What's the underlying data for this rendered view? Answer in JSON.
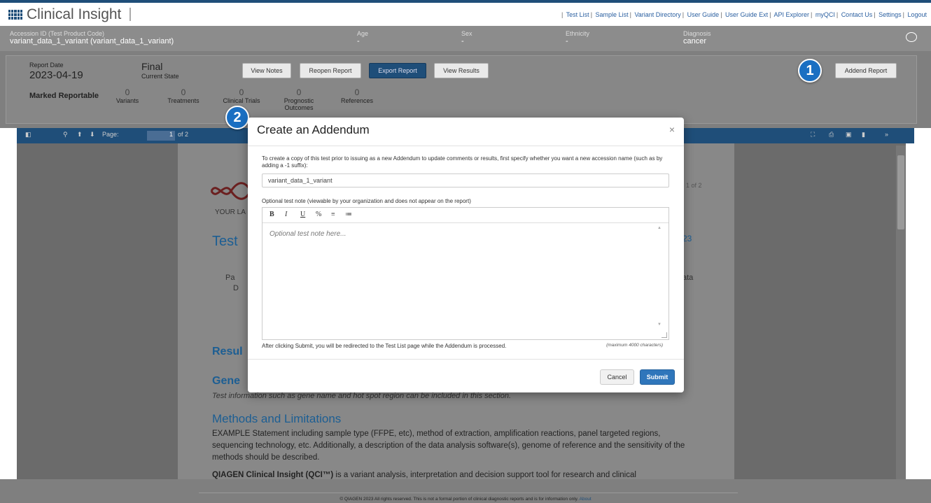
{
  "app": {
    "title": "Clinical Insight"
  },
  "nav_links": [
    "Test List",
    "Sample List",
    "Variant Directory",
    "User Guide",
    "User Guide Ext",
    "API Explorer",
    "myQCI",
    "Contact Us",
    "Settings",
    "Logout"
  ],
  "accession": {
    "accession_label": "Accession ID (Test Product Code)",
    "accession_value": "variant_data_1_variant  (variant_data_1_variant)",
    "age_label": "Age",
    "age_value": "-",
    "sex_label": "Sex",
    "sex_value": "-",
    "ethnicity_label": "Ethnicity",
    "ethnicity_value": "-",
    "diagnosis_label": "Diagnosis",
    "diagnosis_value": "cancer"
  },
  "report": {
    "date_label": "Report Date",
    "date_value": "2023-04-19",
    "state_value": "Final",
    "state_label": "Current State",
    "buttons": {
      "view_notes": "View Notes",
      "reopen": "Reopen Report",
      "export": "Export Report",
      "view_results": "View Results",
      "addend": "Addend Report"
    },
    "marked_label": "Marked Reportable",
    "counts": [
      {
        "n": "0",
        "label": "Variants"
      },
      {
        "n": "0",
        "label": "Treatments"
      },
      {
        "n": "0",
        "label": "Clinical Trials"
      },
      {
        "n": "0",
        "label": "Prognostic Outcomes"
      },
      {
        "n": "0",
        "label": "References"
      }
    ]
  },
  "badges": {
    "one": "1",
    "two": "2"
  },
  "viewer": {
    "page_label": "Page:",
    "page_value": "1",
    "page_of": "of 2",
    "paper": {
      "page_num": "1 of 2",
      "your_lab": "YOUR LA",
      "test": "Test",
      "date_suffix": "23",
      "pa": "Pa",
      "d": "D",
      "data": "ata",
      "results": "Resul",
      "gene": "Gene",
      "gene_info": "Test information such as gene name and hot spot region can be included in this section.",
      "methods_title": "Methods and Limitations",
      "methods_text": "EXAMPLE Statement including sample type (FFPE, etc), method of extraction, amplification reactions, panel targeted regions, sequencing technology, etc. Additionally, a description of the data analysis software(s), genome of reference and the sensitivity of the methods should be described.",
      "qci_bold": "QIAGEN Clinical Insight (QCI™)",
      "qci_text": " is a variant analysis, interpretation and decision support tool for research and clinical"
    }
  },
  "modal": {
    "title": "Create an Addendum",
    "close": "×",
    "intro": "To create a copy of this test prior to issuing as a new Addendum to update comments or results, first specify whether you want a new accession name (such as by adding a -1 suffix):",
    "accession_input_value": "variant_data_1_variant",
    "note_label": "Optional test note (viewable by your organization and does not appear on the report)",
    "note_placeholder": "Optional test note here...",
    "after_submit": "After clicking Submit, you will be redirected to the Test List page while the Addendum is processed.",
    "max_chars": "(maximum 4000 characters)",
    "cancel": "Cancel",
    "submit": "Submit",
    "toolbar": {
      "bold": "B",
      "italic": "I",
      "underline": "U",
      "link": "%",
      "ordered_list": "≡",
      "unordered_list": "≔"
    }
  },
  "footer": {
    "text": "© QIAGEN 2023 All rights reserved. This is not a formal portion of clinical diagnostic reports and is for information only.",
    "about": "About"
  },
  "colors": {
    "brand": "#1f4e79",
    "submit": "#2f76bb",
    "badge": "#1a6fc2"
  }
}
